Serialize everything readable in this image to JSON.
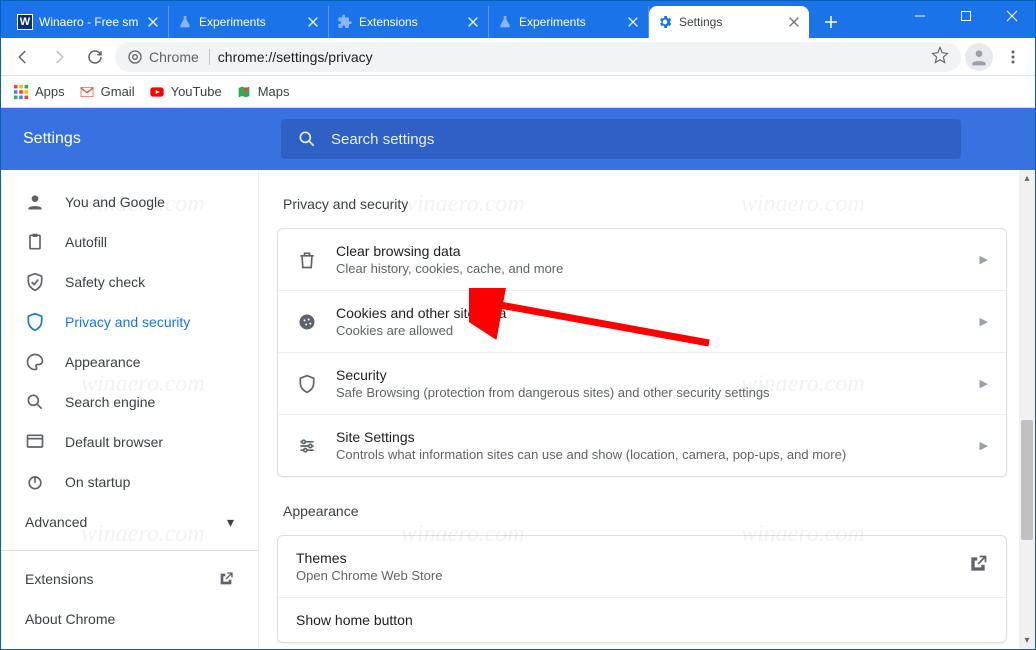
{
  "window": {
    "title": "Chrome"
  },
  "tabs": [
    {
      "title": "Winaero - Free sm",
      "favicon": "w"
    },
    {
      "title": "Experiments",
      "favicon": "flask"
    },
    {
      "title": "Extensions",
      "favicon": "ext"
    },
    {
      "title": "Experiments",
      "favicon": "flask"
    },
    {
      "title": "Settings",
      "favicon": "gear",
      "active": true
    }
  ],
  "toolbar": {
    "url_chip_label": "Chrome",
    "url_text": "chrome://settings/privacy"
  },
  "bookmarks": {
    "apps": "Apps",
    "gmail": "Gmail",
    "youtube": "YouTube",
    "maps": "Maps"
  },
  "header": {
    "brand": "Settings",
    "search_placeholder": "Search settings"
  },
  "sidebar": {
    "items": [
      {
        "label": "You and Google"
      },
      {
        "label": "Autofill"
      },
      {
        "label": "Safety check"
      },
      {
        "label": "Privacy and security"
      },
      {
        "label": "Appearance"
      },
      {
        "label": "Search engine"
      },
      {
        "label": "Default browser"
      },
      {
        "label": "On startup"
      }
    ],
    "advanced": "Advanced",
    "extensions": "Extensions",
    "about": "About Chrome"
  },
  "sections": {
    "privacy_title": "Privacy and security",
    "privacy_rows": [
      {
        "title": "Clear browsing data",
        "sub": "Clear history, cookies, cache, and more"
      },
      {
        "title": "Cookies and other site data",
        "sub": "Cookies are allowed"
      },
      {
        "title": "Security",
        "sub": "Safe Browsing (protection from dangerous sites) and other security settings"
      },
      {
        "title": "Site Settings",
        "sub": "Controls what information sites can use and show (location, camera, pop-ups, and more)"
      }
    ],
    "appearance_title": "Appearance",
    "appearance_rows": [
      {
        "title": "Themes",
        "sub": "Open Chrome Web Store"
      },
      {
        "title": "Show home button",
        "sub": ""
      }
    ]
  },
  "watermark": "winaero.com"
}
